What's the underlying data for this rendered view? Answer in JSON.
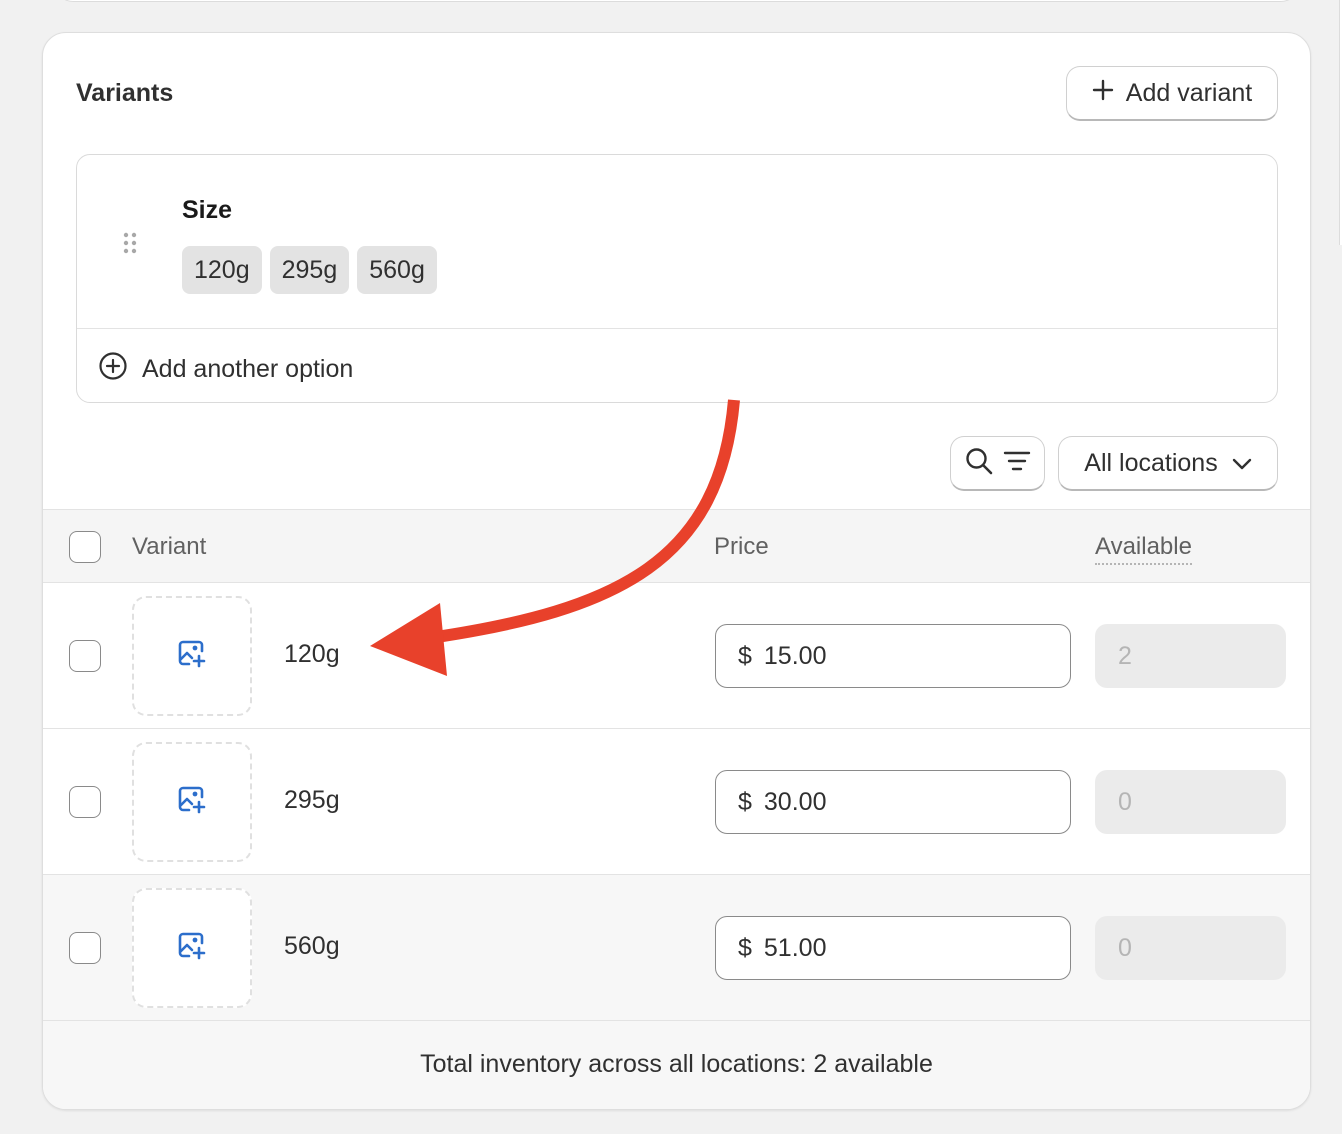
{
  "variants_card": {
    "title": "Variants",
    "add_variant_label": "Add variant"
  },
  "options": [
    {
      "name": "Size",
      "values": [
        "120g",
        "295g",
        "560g"
      ]
    }
  ],
  "add_option_label": "Add another option",
  "toolbar": {
    "locations_label": "All locations"
  },
  "table": {
    "columns": {
      "variant": "Variant",
      "price": "Price",
      "available": "Available"
    },
    "rows": [
      {
        "name": "120g",
        "currency": "$",
        "price": "15.00",
        "available": "2"
      },
      {
        "name": "295g",
        "currency": "$",
        "price": "30.00",
        "available": "0"
      },
      {
        "name": "560g",
        "currency": "$",
        "price": "51.00",
        "available": "0"
      }
    ]
  },
  "footer": {
    "total_text": "Total inventory across all locations: 2 available"
  },
  "colors": {
    "accent_blue": "#2c6ecb",
    "annotation_arrow": "#e8412b"
  },
  "icons": [
    "plus-icon",
    "drag-handle-icon",
    "plus-circle-icon",
    "search-icon",
    "filter-icon",
    "chevron-down-icon",
    "image-add-icon"
  ]
}
